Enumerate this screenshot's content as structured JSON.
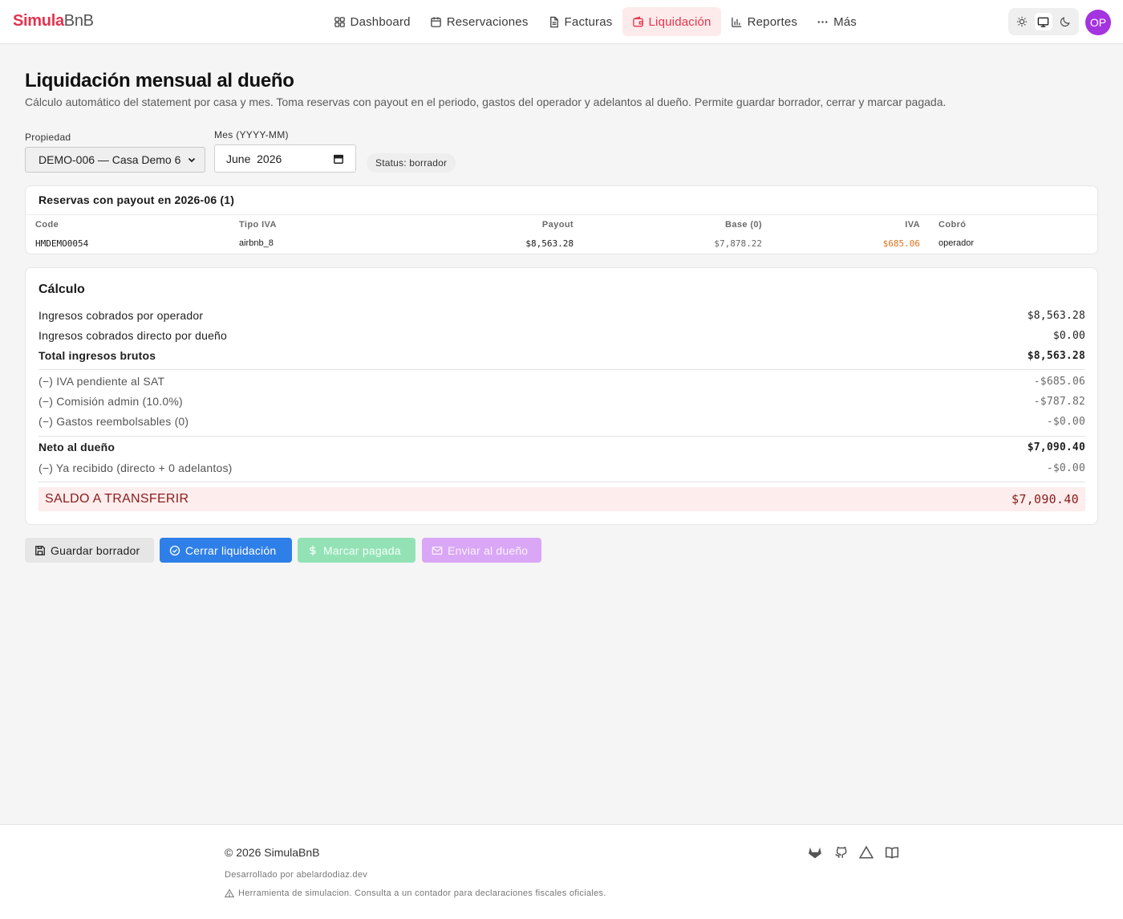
{
  "brand": {
    "part1": "Simula",
    "part2": "BnB"
  },
  "nav": [
    {
      "label": "Dashboard"
    },
    {
      "label": "Reservaciones"
    },
    {
      "label": "Facturas"
    },
    {
      "label": "Liquidación"
    },
    {
      "label": "Reportes"
    },
    {
      "label": "Más"
    }
  ],
  "user": {
    "initials": "OP"
  },
  "page": {
    "title": "Liquidación mensual al dueño",
    "description": "Cálculo automático del statement por casa y mes. Toma reservas con payout en el periodo, gastos del operador y adelantos al dueño. Permite guardar borrador, cerrar y marcar pagada."
  },
  "filters": {
    "property_label": "Propiedad",
    "property_value": "DEMO-006 — Casa Demo 6",
    "month_label": "Mes (YYYY-MM)",
    "month_value": "June  2026",
    "status": "Status: borrador"
  },
  "reservations": {
    "title": "Reservas con payout en 2026-06 (1)",
    "columns": [
      "Code",
      "Tipo IVA",
      "Payout",
      "Base (0)",
      "IVA",
      "Cobró"
    ],
    "rows": [
      {
        "code": "HMDEMO0054",
        "tipo_iva": "airbnb_8",
        "payout": "$8,563.28",
        "base": "$7,878.22",
        "iva": "$685.06",
        "cobro": "operador"
      }
    ]
  },
  "calc": {
    "title": "Cálculo",
    "ing_operador": {
      "label": "Ingresos cobrados por operador",
      "value": "$8,563.28"
    },
    "ing_dueno": {
      "label": "Ingresos cobrados directo por dueño",
      "value": "$0.00"
    },
    "total_bruto": {
      "label": "Total ingresos brutos",
      "value": "$8,563.28"
    },
    "iva_sat": {
      "label": "(−) IVA pendiente al SAT",
      "value": "-$685.06"
    },
    "comision": {
      "label": "(−) Comisión admin (10.0%)",
      "value": "-$787.82"
    },
    "gastos": {
      "label": "(−) Gastos reembolsables (0)",
      "value": "-$0.00"
    },
    "neto": {
      "label": "Neto al dueño",
      "value": "$7,090.40"
    },
    "recibido": {
      "label": "(−) Ya recibido (directo + 0 adelantos)",
      "value": "-$0.00"
    },
    "saldo": {
      "label": "SALDO A TRANSFERIR",
      "value": "$7,090.40"
    }
  },
  "actions": {
    "save": "Guardar borrador",
    "close": "Cerrar liquidación",
    "paid": "Marcar pagada",
    "send": "Enviar al dueño"
  },
  "footer": {
    "copyright": "© 2026 SimulaBnB",
    "developer": "Desarrollado por abelardodiaz.dev",
    "warning": "Herramienta de simulacion. Consulta a un contador para declaraciones fiscales oficiales."
  },
  "colors": {
    "brand": "#e3344f",
    "primary": "#2f7fe8",
    "success_disabled": "#93e2b6",
    "purple_disabled": "#d9a7f5",
    "iva_orange": "#e0731d",
    "avatar": "#a433e0"
  },
  "icons": {
    "nav": [
      "dashboard-icon",
      "calendar-icon",
      "file-icon",
      "wallet-icon",
      "bar-chart-icon",
      "more-dots-icon"
    ],
    "theme": [
      "sun-icon",
      "monitor-icon",
      "moon-icon"
    ],
    "footer": [
      "gitlab-icon",
      "github-icon",
      "triangle-icon",
      "book-icon"
    ]
  }
}
